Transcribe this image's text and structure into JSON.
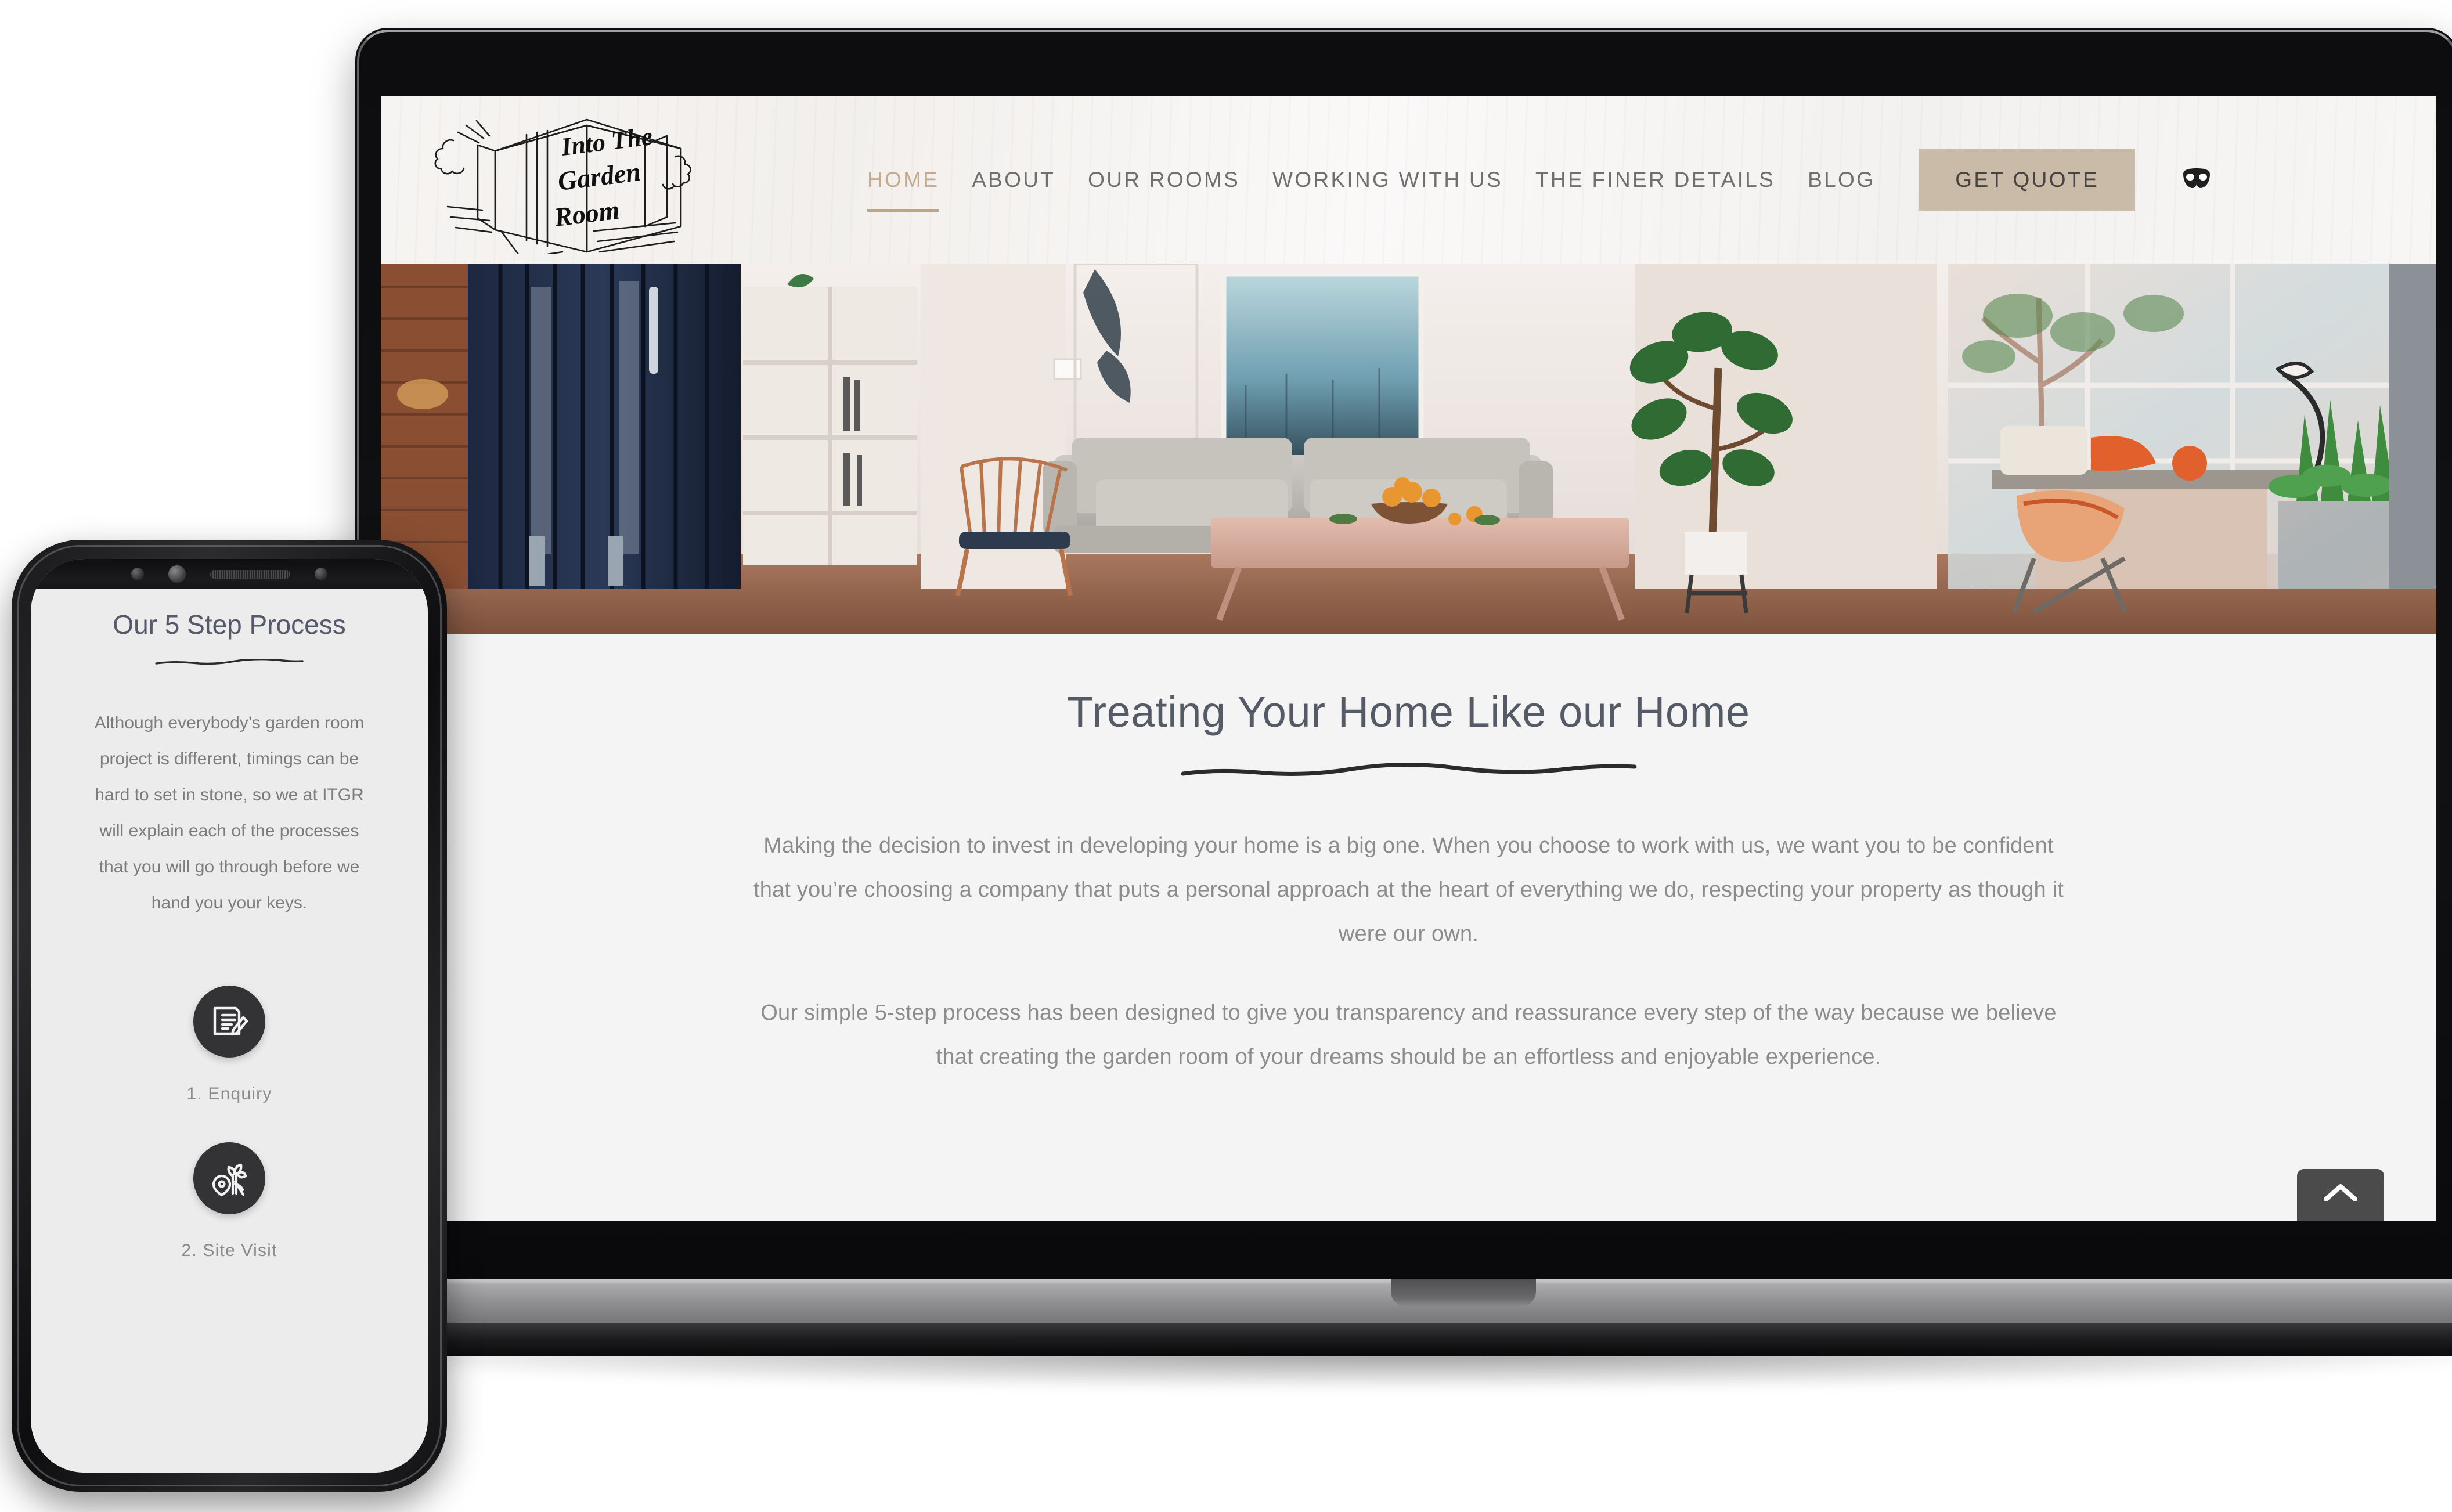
{
  "site": {
    "logo": {
      "line1": "Into The",
      "line2": "Garden",
      "line3": "Room",
      "alt": "Into The Garden Room hand-drawn garden room logo"
    },
    "nav": {
      "items": [
        {
          "label": "HOME",
          "active": true
        },
        {
          "label": "ABOUT",
          "active": false
        },
        {
          "label": "OUR ROOMS",
          "active": false
        },
        {
          "label": "WORKING WITH US",
          "active": false
        },
        {
          "label": "THE FINER DETAILS",
          "active": false
        },
        {
          "label": "BLOG",
          "active": false
        }
      ],
      "cta_label": "GET QUOTE",
      "social_icon": "mask-icon"
    },
    "hero": {
      "alt": "Modern garden room interior with grey sofa, pink coffee table, rattan chair, navy bifold doors and plants"
    },
    "main": {
      "heading": "Treating Your Home Like our Home",
      "paragraph_1": "Making the decision to invest in developing your home is a big one. When you choose to work with us, we want you to be confident that you’re choosing a company that puts a personal approach at the heart of everything we do, respecting your property as though it were our own.",
      "paragraph_2": "Our simple 5-step process has been designed to give you transparency and reassurance every step of the way because we believe that creating the garden room of your dreams should be an effortless and enjoyable experience."
    },
    "scroll_top_label": "⌃"
  },
  "phone": {
    "heading": "Our 5 Step Process",
    "paragraph": "Although everybody’s garden room project is different, timings can be hard to set in stone, so we at ITGR will explain each of the processes that you will go through before we hand you your keys.",
    "steps": [
      {
        "label": "1. Enquiry",
        "icon": "document-pencil-icon"
      },
      {
        "label": "2. Site Visit",
        "icon": "map-pin-plants-icon"
      }
    ]
  },
  "colors": {
    "accent": "#c0a684",
    "cta_background": "#c9bba8",
    "cta_text": "#474340",
    "heading": "#545b66",
    "body_text": "#8c8c8c",
    "nav_text": "#6f6f6f",
    "content_background": "#f4f4f4",
    "phone_background": "#ececec",
    "step_circle": "#333335"
  }
}
